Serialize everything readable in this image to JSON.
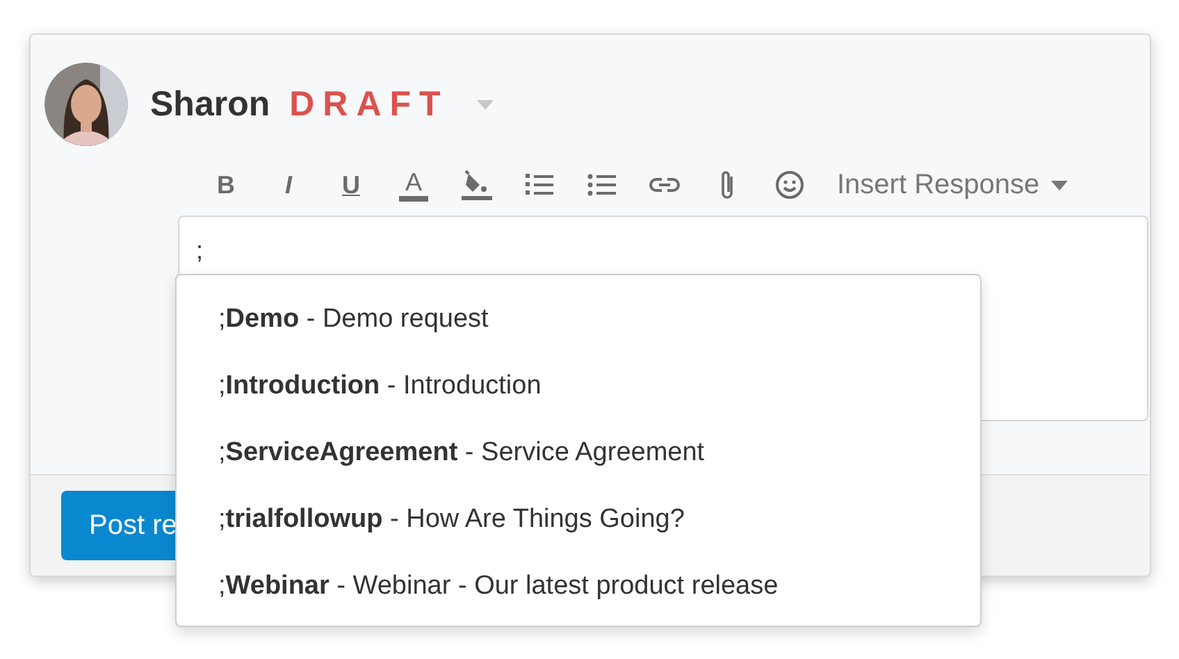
{
  "header": {
    "author": "Sharon",
    "status": "DRAFT"
  },
  "toolbar": [
    {
      "kind": "bold",
      "label": "B"
    },
    {
      "kind": "italic",
      "label": "I"
    },
    {
      "kind": "underline",
      "label": "U"
    },
    {
      "kind": "text-color",
      "label": "A"
    },
    {
      "kind": "fill-color"
    },
    {
      "kind": "ordered-list"
    },
    {
      "kind": "bullet-list"
    },
    {
      "kind": "link"
    },
    {
      "kind": "attachment"
    },
    {
      "kind": "emoji"
    }
  ],
  "insert_response": {
    "label": "Insert Response"
  },
  "editor": {
    "value": ";"
  },
  "suggestions": [
    {
      "text": ";**Demo** - Demo request"
    },
    {
      "text": ";**Introduction** - Introduction"
    },
    {
      "text": ";**ServiceAgreement** - Service Agreement"
    },
    {
      "text": ";**trialfollowup** - How Are Things Going?"
    },
    {
      "text": ";**Webinar** - Webinar - Our latest product release"
    }
  ],
  "footer": {
    "button": "Post re"
  }
}
